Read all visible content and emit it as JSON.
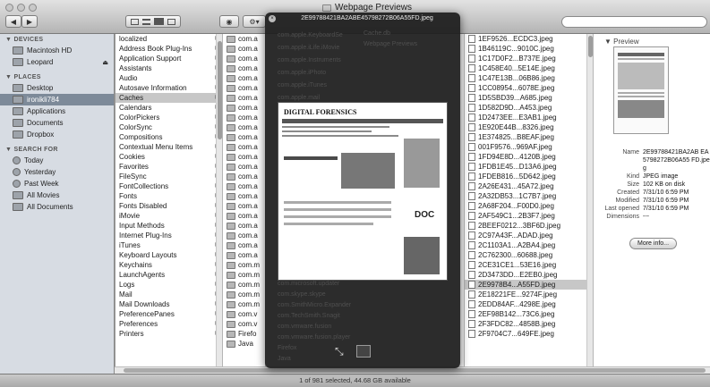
{
  "window": {
    "title": "Webpage Previews"
  },
  "toolbar": {
    "back": "◀",
    "forward": "▶",
    "search_placeholder": ""
  },
  "sidebar": {
    "devices_header": "▼ DEVICES",
    "devices": [
      "Macintosh HD",
      "Leopard"
    ],
    "places_header": "▼ PLACES",
    "places": [
      "Desktop",
      "ironikli784",
      "Applications",
      "Documents",
      "Dropbox"
    ],
    "search_header": "▼ SEARCH FOR",
    "search_for": [
      "Today",
      "Yesterday",
      "Past Week",
      "All Movies",
      "All Documents"
    ]
  },
  "column1": {
    "items": [
      "localized",
      "Address Book Plug-Ins",
      "Application Support",
      "Assistants",
      "Audio",
      "Autosave Information",
      "Caches",
      "Calendars",
      "ColorPickers",
      "ColorSync",
      "Compositions",
      "Contextual Menu Items",
      "Cookies",
      "Favorites",
      "FileSync",
      "FontCollections",
      "Fonts",
      "Fonts Disabled",
      "iMovie",
      "Input Methods",
      "Internet Plug-Ins",
      "iTunes",
      "Keyboard Layouts",
      "Keychains",
      "LaunchAgents",
      "Logs",
      "Mail",
      "Mail Downloads",
      "PreferencePanes",
      "Preferences",
      "Printers"
    ],
    "selected_index": 6
  },
  "column2": {
    "items": [
      "com.a",
      "com.a",
      "com.a",
      "com.a",
      "com.a",
      "com.a",
      "com.a",
      "com.a",
      "com.a",
      "com.a",
      "com.a",
      "com.a",
      "com.a",
      "com.a",
      "com.a",
      "com.a",
      "com.a",
      "com.a",
      "com.a",
      "com.a",
      "com.a",
      "com.a",
      "com.a",
      "com.m",
      "com.m",
      "com.m",
      "com.m",
      "com.m",
      "com.v",
      "com.v",
      "Firefo",
      "Java"
    ]
  },
  "column4": {
    "items": [
      "1EF9526...ECDC3.jpeg",
      "1B46119C...9010C.jpeg",
      "1C17D0F2...B737E.jpeg",
      "1C458E40...5E14E.jpeg",
      "1C47E13B...06B86.jpeg",
      "1CC08954...6078E.jpeg",
      "1D5SBD39...A685.jpeg",
      "1D582D9D...A453.jpeg",
      "1D2473EE...E3AB1.jpeg",
      "1E920E44B...8326.jpeg",
      "1E374825...B8EAF.jpeg",
      "001F9576...969AF.jpeg",
      "1FD94E8D...4120B.jpeg",
      "1FDB1E45...D13A6.jpeg",
      "1FDEB816...5D642.jpeg",
      "2A26E431...45A72.jpeg",
      "2A32DB53...1C7B7.jpeg",
      "2A68F204...F00D0.jpeg",
      "2AF549C1...2B3F7.jpeg",
      "2BEEF0212...3BF6D.jpeg",
      "2C97A43F...ADAD.jpeg",
      "2C1103A1...A2BA4.jpeg",
      "2C762300...60688.jpeg",
      "2CE31CE1...53E16.jpeg",
      "2D3473DD...E2EB0.jpeg",
      "2E9978B4...A55FD.jpeg",
      "2E18221FE...9274F.jpeg",
      "2EDD84AF...4298E.jpeg",
      "2EF98B142...73C6.jpeg",
      "2F3FDC82...4858B.jpeg",
      "2F9704C7...649FE.jpeg"
    ],
    "selected_index": 25
  },
  "preview": {
    "header": "▼ Preview",
    "meta": [
      {
        "key": "Name",
        "value": "2E99788421BA2AB EA5798272B06A55 FD.jpeg"
      },
      {
        "key": "Kind",
        "value": "JPEG image"
      },
      {
        "key": "Size",
        "value": "102 KB on disk"
      },
      {
        "key": "Created",
        "value": "7/31/10 6:59 PM"
      },
      {
        "key": "Modified",
        "value": "7/31/10 6:59 PM"
      },
      {
        "key": "Last opened",
        "value": "7/31/10 6:59 PM"
      },
      {
        "key": "Dimensions",
        "value": "---"
      }
    ],
    "more_info": "More info..."
  },
  "quicklook": {
    "title": "2E99788421BA2ABE45798272B06A55FD.jpeg",
    "doc_title": "DIGITAL FORENSICS",
    "doc_logo": "DOC",
    "ghost_items": [
      "Cache.db",
      "Webpage Previews",
      "com.apple.KeyboardSe",
      "com.apple.iLife.iMovie",
      "com.apple.Instruments",
      "com.apple.iPhoto",
      "com.apple.iTunes",
      "com.apple.mail",
      "Microsoft Word",
      "com.microsoft.updater",
      "com.skype.skype",
      "com.SmithMicro.Expander",
      "com.TechSmith.Snagit",
      "com.vmware.fusion",
      "com.vmware.fusion.player",
      "Firefox",
      "Java"
    ]
  },
  "status": {
    "text": "1 of 981 selected, 44.68 GB available"
  }
}
